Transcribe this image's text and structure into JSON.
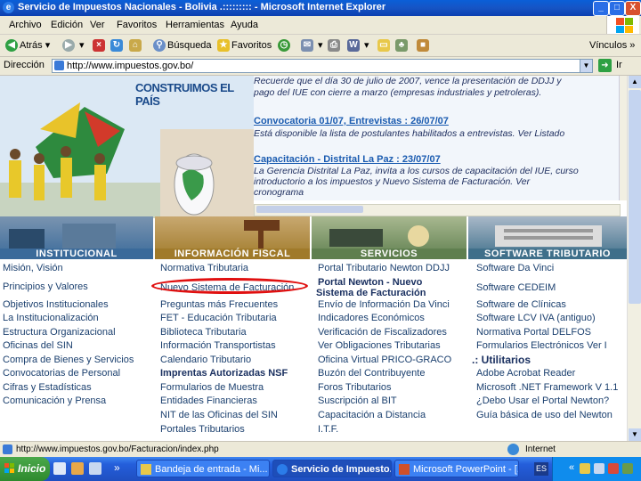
{
  "window": {
    "title": "Servicio de Impuestos Nacionales - Bolivia .::::::::: - Microsoft Internet Explorer",
    "icon": "ie-icon",
    "min": "_",
    "max": "□",
    "close": "X"
  },
  "menu": [
    "Archivo",
    "Edición",
    "Ver",
    "Favoritos",
    "Herramientas",
    "Ayuda"
  ],
  "toolbar": {
    "back": "Atrás",
    "search": "Búsqueda",
    "favorites": "Favoritos",
    "links": "Vínculos",
    "links_arrow": "»"
  },
  "address": {
    "label": "Dirección",
    "url": "http://www.impuestos.gov.bo/",
    "go": "Ir"
  },
  "banner": {
    "slogan": "CONSTRUIMOS EL PAÍS"
  },
  "news": [
    {
      "type": "text",
      "text": "Recuerde que el día 30 de julio de 2007, vence la presentación de DDJJ y"
    },
    {
      "type": "text",
      "text": "pago del IUE con cierre a marzo (empresas industriales y petroleras)."
    },
    {
      "type": "head",
      "text": "Convocatoria 01/07, Entrevistas : 26/07/07"
    },
    {
      "type": "text",
      "text": "Está disponible la lista de postulantes habilitados a entrevistas. Ver Listado"
    },
    {
      "type": "head",
      "text": "Capacitación - Distrital La Paz : 23/07/07"
    },
    {
      "type": "text",
      "text": "La Gerencia Distrital La Paz, invita a los cursos de capacitación del IUE, curso"
    },
    {
      "type": "text",
      "text": "introductorio a los impuestos y Nuevo Sistema de Facturación. Ver"
    },
    {
      "type": "text",
      "text": "cronograma"
    }
  ],
  "sections": [
    {
      "title": "INSTITUCIONAL",
      "links": [
        "Misión, Visión",
        "Principios y Valores",
        "Objetivos Institucionales",
        "La Institucionalización",
        "Estructura Organizacional",
        "Oficinas del SIN",
        "Compra de Bienes y Servicios",
        "Convocatorias de Personal",
        "Cifras y Estadísticas",
        "Comunicación y Prensa"
      ]
    },
    {
      "title": "INFORMACIÓN FISCAL",
      "links": [
        "Normativa Tributaria",
        "Nuevo Sistema de Facturación",
        "Preguntas más Frecuentes",
        "FET - Educación Tributaria",
        "Biblioteca Tributaria",
        "Información Transportistas",
        "Calendario Tributario",
        "Imprentas Autorizadas NSF",
        "Formularios de Muestra",
        "Entidades Financieras",
        "NIT de las Oficinas del SIN",
        "Portales Tributarios"
      ]
    },
    {
      "title": "SERVICIOS",
      "links": [
        "Portal Tributario Newton DDJJ",
        "Portal Newton - Nuevo",
        "Sistema de Facturación",
        "Envío de Información Da Vinci",
        "Indicadores Económicos",
        "Verificación de Fiscalizadores",
        "Ver Obligaciones Tributarias",
        "Oficina Virtual PRICO-GRACO",
        "Buzón del Contribuyente",
        "Foros Tributarios",
        "Suscripción al BIT",
        "Capacitación a Distancia",
        "I.T.F."
      ]
    },
    {
      "title": "SOFTWARE TRIBUTARIO",
      "links": [
        "Software Da Vinci",
        "Software CEDEIM",
        "Software de Clínicas",
        "Software LCV IVA (antiguo)",
        "Normativa Portal DELFOS",
        "Formularios Electrónicos Ver I",
        ".: Utilitarios",
        "Adobe Acrobat Reader",
        "Microsoft .NET Framework V 1.1",
        "¿Debo Usar el Portal Newton?",
        "Guía básica de uso del Newton"
      ]
    }
  ],
  "status": {
    "url": "http://www.impuestos.gov.bo/Facturacion/index.php",
    "zone": "Internet"
  },
  "taskbar": {
    "start": "Inicio",
    "arrows": "»",
    "tasks": [
      "Bandeja de entrada - Mi...",
      "Servicio de Impuesto...",
      "Microsoft PowerPoint - [..."
    ],
    "lang": "ES",
    "tray_arrow": "«"
  },
  "colors": {
    "xp_blue": "#245edb",
    "section_institucional": "#3a6a9a",
    "section_fiscal": "#a07a2a",
    "section_servicios": "#5f7f4f",
    "section_software": "#3f6f8a",
    "highlight_oval": "#e01010"
  }
}
